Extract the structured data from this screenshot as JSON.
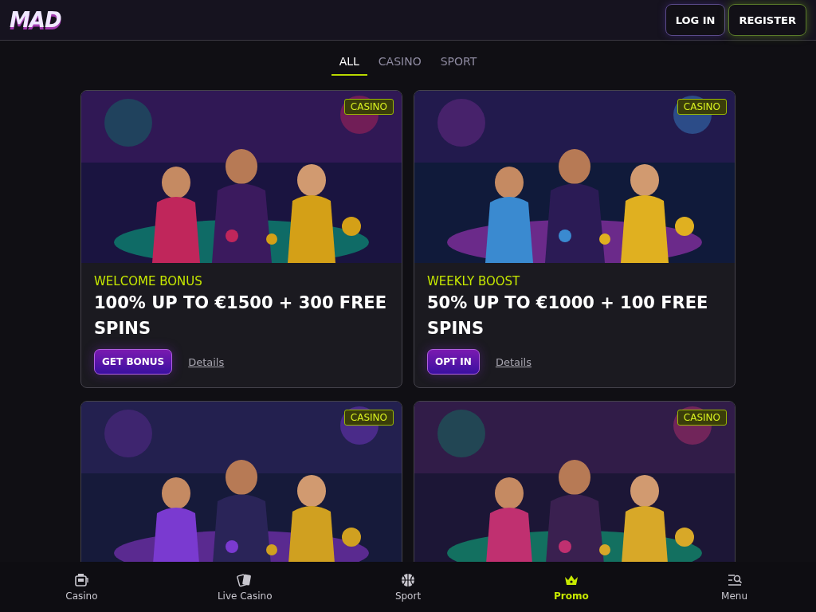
{
  "header": {
    "logo": "MAD",
    "buttons": [
      {
        "label": "LOG IN",
        "kind": "login"
      },
      {
        "label": "REGISTER",
        "kind": "register"
      }
    ]
  },
  "tabs": [
    {
      "label": "ALL",
      "selected": true
    },
    {
      "label": "CASINO",
      "selected": false
    },
    {
      "label": "SPORT",
      "selected": false
    }
  ],
  "promos": [
    {
      "tag": "CASINO",
      "subtitle": "WELCOME BONUS",
      "title": "100% UP TO €1500 + 300 FREE SPINS",
      "button": "GET BONUS",
      "link": "Details"
    },
    {
      "tag": "CASINO",
      "subtitle": "WEEKLY BOOST",
      "title": "50% UP TO €1000 + 100 FREE SPINS",
      "button": "OPT IN",
      "link": "Details"
    },
    {
      "tag": "CASINO"
    },
    {
      "tag": "CASINO"
    }
  ],
  "bottom_nav": [
    {
      "label": "Casino",
      "kind": "casino",
      "selected": false
    },
    {
      "label": "Live Casino",
      "kind": "live",
      "selected": false
    },
    {
      "label": "Sport",
      "kind": "sport",
      "selected": false
    },
    {
      "label": "Promo",
      "kind": "promo",
      "selected": true
    },
    {
      "label": "Menu",
      "kind": "menu",
      "selected": false
    }
  ]
}
